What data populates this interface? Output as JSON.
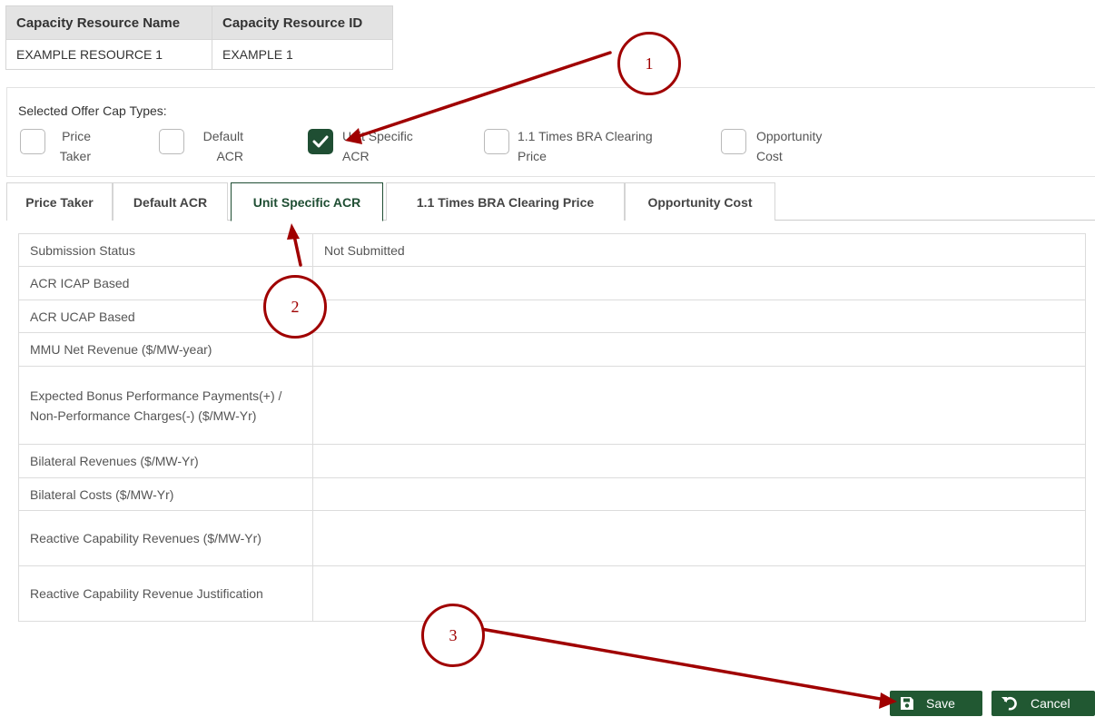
{
  "resource_table": {
    "headers": [
      "Capacity Resource Name",
      "Capacity Resource ID"
    ],
    "row": [
      "EXAMPLE RESOURCE 1",
      "EXAMPLE 1"
    ]
  },
  "offer_cap": {
    "title": "Selected Offer Cap Types:",
    "options": [
      {
        "line1": "Price",
        "line2": "Taker",
        "checked": false
      },
      {
        "line1": "Default",
        "line2": "ACR",
        "checked": false
      },
      {
        "line1": "Unit Specific",
        "line2": "ACR",
        "checked": true
      },
      {
        "line1": "1.1 Times BRA Clearing",
        "line2": "Price",
        "checked": false
      },
      {
        "line1": "Opportunity",
        "line2": "Cost",
        "checked": false
      }
    ]
  },
  "tabs": [
    {
      "label": "Price Taker",
      "active": false
    },
    {
      "label": "Default ACR",
      "active": false
    },
    {
      "label": "Unit Specific ACR",
      "active": true
    },
    {
      "label": "1.1 Times BRA Clearing Price",
      "active": false
    },
    {
      "label": "Opportunity Cost",
      "active": false
    }
  ],
  "details": [
    {
      "label": "Submission Status",
      "value": "Not Submitted"
    },
    {
      "label": "ACR ICAP Based",
      "value": ""
    },
    {
      "label": "ACR UCAP Based",
      "value": ""
    },
    {
      "label": "MMU Net Revenue ($/MW-year)",
      "value": ""
    },
    {
      "label": "Expected Bonus Performance Payments(+) / Non-Performance Charges(-) ($/MW-Yr)",
      "value": ""
    },
    {
      "label": "Bilateral Revenues ($/MW-Yr)",
      "value": ""
    },
    {
      "label": "Bilateral Costs ($/MW-Yr)",
      "value": ""
    },
    {
      "label": "Reactive Capability Revenues ($/MW-Yr)",
      "value": ""
    },
    {
      "label": "Reactive Capability Revenue Justification",
      "value": ""
    }
  ],
  "buttons": {
    "save": "Save",
    "cancel": "Cancel"
  },
  "annotations": [
    "1",
    "2",
    "3"
  ],
  "colors": {
    "accent": "#215832",
    "annotation": "#a00000"
  }
}
